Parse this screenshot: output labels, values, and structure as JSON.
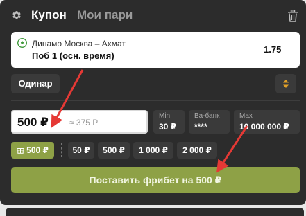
{
  "header": {
    "tab_active": "Купон",
    "tab_inactive": "Мои пари",
    "settings_icon": "gear-icon",
    "delete_icon": "trash-icon"
  },
  "bet": {
    "match": "Динамо Москва – Ахмат",
    "outcome": "Поб 1 (осн. время)",
    "odds": "1.75",
    "sport_icon": "football-icon"
  },
  "bet_type": {
    "label": "Одинар"
  },
  "stake": {
    "value": "500 ₽",
    "converted": "≈ 375 Р"
  },
  "limits": [
    {
      "label": "Min",
      "value": "30 ₽"
    },
    {
      "label": "Ва-банк",
      "value": "****"
    },
    {
      "label": "Max",
      "value": "10 000 000 ₽"
    }
  ],
  "freebet_chip": "500 ₽",
  "quick_amounts": [
    "50 ₽",
    "500 ₽",
    "1 000 ₽",
    "2 000 ₽"
  ],
  "place_button": "Поставить фрибет на 500 ₽",
  "colors": {
    "accent": "#8ea146",
    "panel": "#2c2c2c",
    "arrow": "#e53935"
  }
}
